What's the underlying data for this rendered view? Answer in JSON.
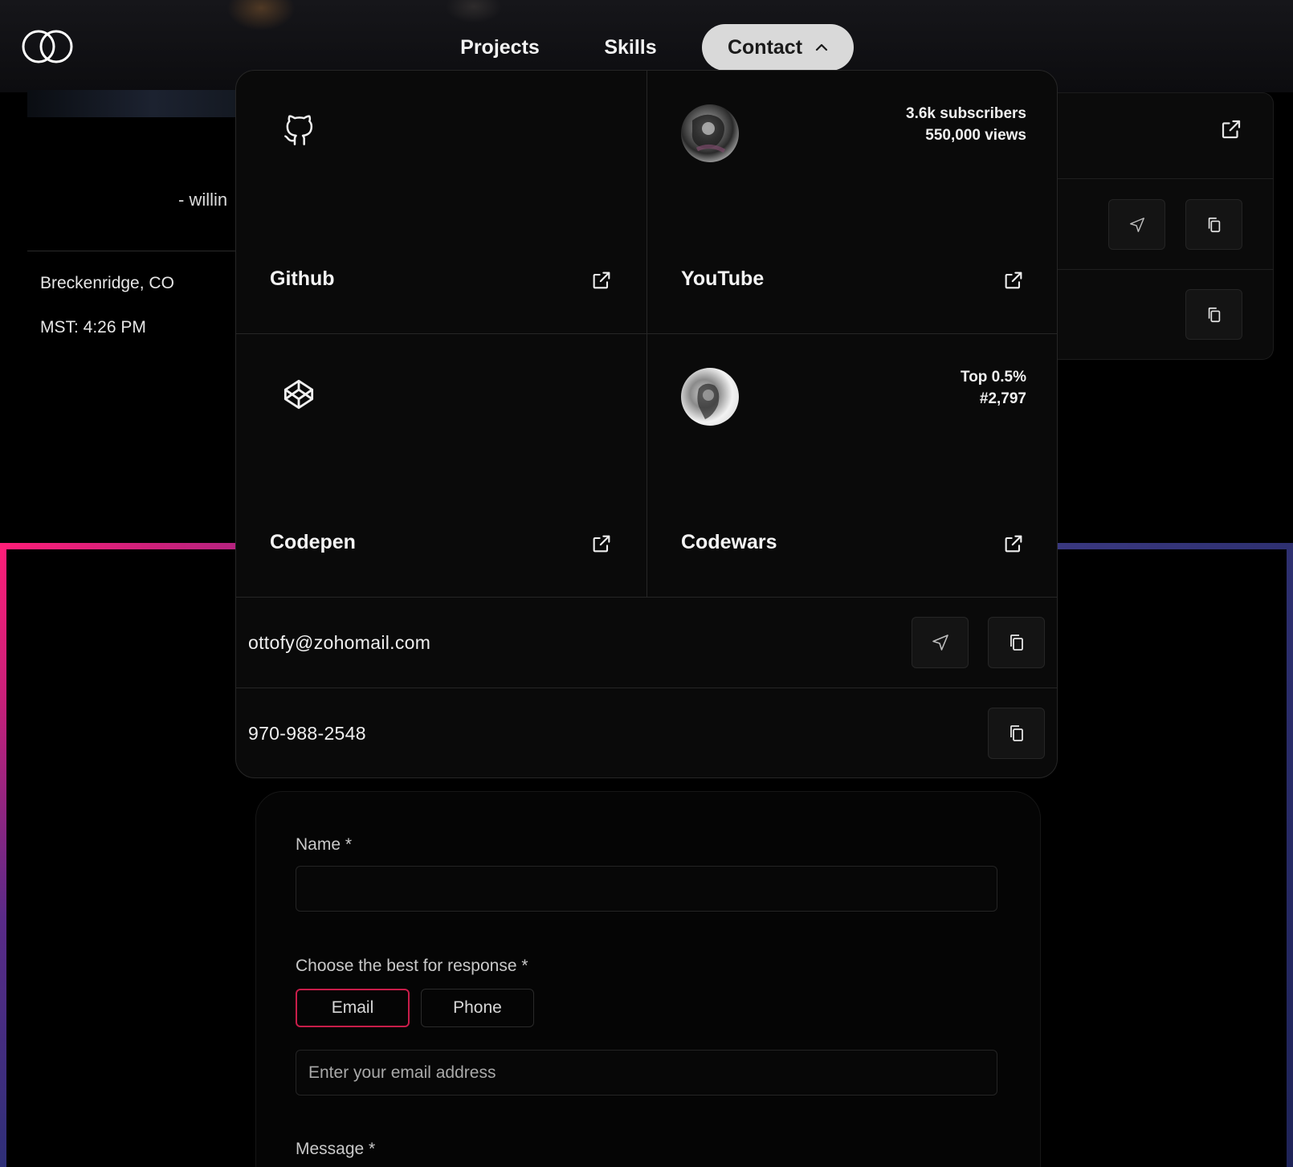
{
  "nav": {
    "projects": "Projects",
    "skills": "Skills",
    "contact": "Contact"
  },
  "background": {
    "quote_fragment": "- willin",
    "location": "Breckenridge, CO",
    "time": "MST: 4:26 PM"
  },
  "dropdown": {
    "cards": [
      {
        "title": "Github",
        "icon": "github-icon"
      },
      {
        "title": "YouTube",
        "stat_line_1": "3.6k subscribers",
        "stat_line_2": "550,000 views"
      },
      {
        "title": "Codepen",
        "icon": "codepen-icon"
      },
      {
        "title": "Codewars",
        "stat_line_1": "Top 0.5%",
        "stat_line_2": "#2,797"
      }
    ],
    "email": "ottofy@zohomail.com",
    "phone": "970-988-2548"
  },
  "form": {
    "name_label": "Name *",
    "name_value": "",
    "response_label": "Choose the best for response *",
    "options": [
      "Email",
      "Phone"
    ],
    "selected_option": "Email",
    "email_placeholder": "Enter your email address",
    "message_label": "Message *"
  },
  "colors": {
    "accent_pink": "#ff1e78",
    "accent_indigo": "#2e3070",
    "active_toggle_border": "#c81d4a",
    "contact_pill": "#d9d9d9"
  }
}
